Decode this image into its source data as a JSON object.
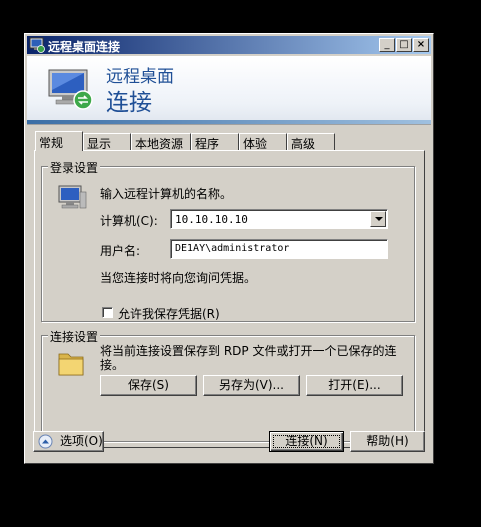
{
  "window": {
    "title": "远程桌面连接",
    "controls": {
      "minimize": "_",
      "maximize": "□",
      "close": "×"
    }
  },
  "banner": {
    "subtitle": "远程桌面",
    "title": "连接"
  },
  "tabs": [
    {
      "label": "常规",
      "active": true
    },
    {
      "label": "显示",
      "active": false
    },
    {
      "label": "本地资源",
      "active": false
    },
    {
      "label": "程序",
      "active": false
    },
    {
      "label": "体验",
      "active": false
    },
    {
      "label": "高级",
      "active": false
    }
  ],
  "login": {
    "legend": "登录设置",
    "instruction": "输入远程计算机的名称。",
    "computer_label": "计算机(C):",
    "computer_value": "10.10.10.10",
    "username_label": "用户名:",
    "username_value": "DE1AY\\administrator",
    "note": "当您连接时将向您询问凭据。",
    "save_credentials_label": "允许我保存凭据(R)",
    "save_credentials_checked": false
  },
  "connection": {
    "legend": "连接设置",
    "description": "将当前连接设置保存到 RDP 文件或打开一个已保存的连接。",
    "save_button": "保存(S)",
    "save_as_button": "另存为(V)...",
    "open_button": "打开(E)..."
  },
  "footer": {
    "options_label": "选项(O)",
    "connect_button": "连接(N)",
    "help_button": "帮助(H)"
  },
  "icons": {
    "app": "remote-desktop-icon",
    "banner": "remote-desktop-icon",
    "computer": "computer-icon",
    "folder": "folder-icon",
    "options": "chevron-up-icon"
  }
}
